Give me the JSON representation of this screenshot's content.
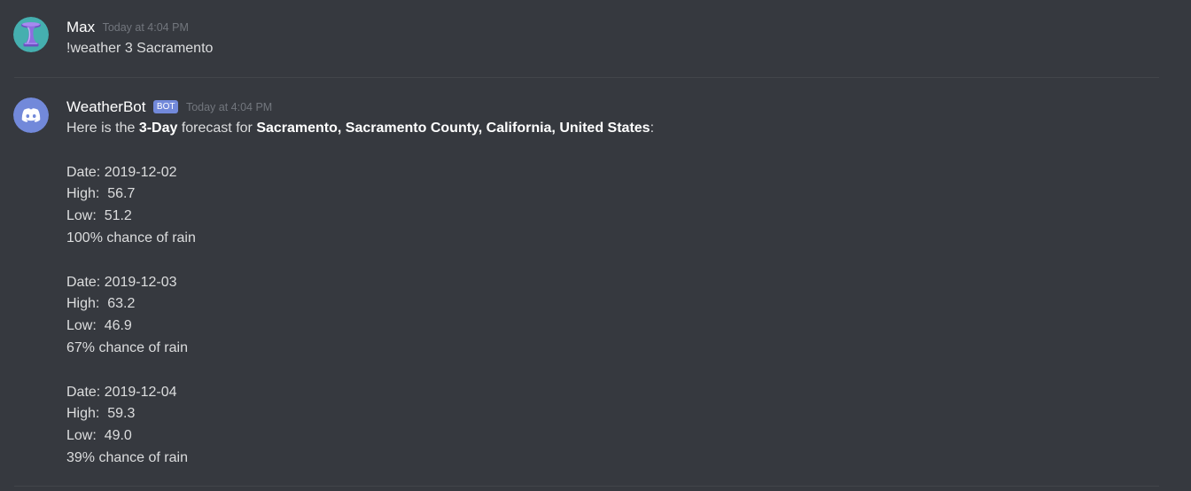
{
  "messages": {
    "user": {
      "name": "Max",
      "timestamp": "Today at 4:04 PM",
      "text": "!weather 3 Sacramento",
      "avatar_icon": "purple-anvil-icon",
      "avatar_color": "#3fa6a6"
    },
    "bot": {
      "name": "WeatherBot",
      "tag": "BOT",
      "timestamp": "Today at 4:04 PM",
      "avatar_icon": "discord-logo-icon",
      "avatar_color": "#7289da",
      "intro_prefix": "Here is the ",
      "intro_bold": "3-Day",
      "intro_middle": " forecast for ",
      "intro_location": "Sacramento, Sacramento County, California, United States",
      "intro_suffix": ":",
      "days": [
        {
          "date": "Date: 2019-12-02",
          "high": "High:  56.7",
          "low": "Low:  51.2",
          "rain": "100% chance of rain"
        },
        {
          "date": "Date: 2019-12-03",
          "high": "High:  63.2",
          "low": "Low:  46.9",
          "rain": "67% chance of rain"
        },
        {
          "date": "Date: 2019-12-04",
          "high": "High:  59.3",
          "low": "Low:  49.0",
          "rain": "39% chance of rain"
        }
      ]
    }
  },
  "colors": {
    "background": "#36393f",
    "bot_tag": "#7289da",
    "text": "#dcddde",
    "timestamp": "#72767d"
  }
}
